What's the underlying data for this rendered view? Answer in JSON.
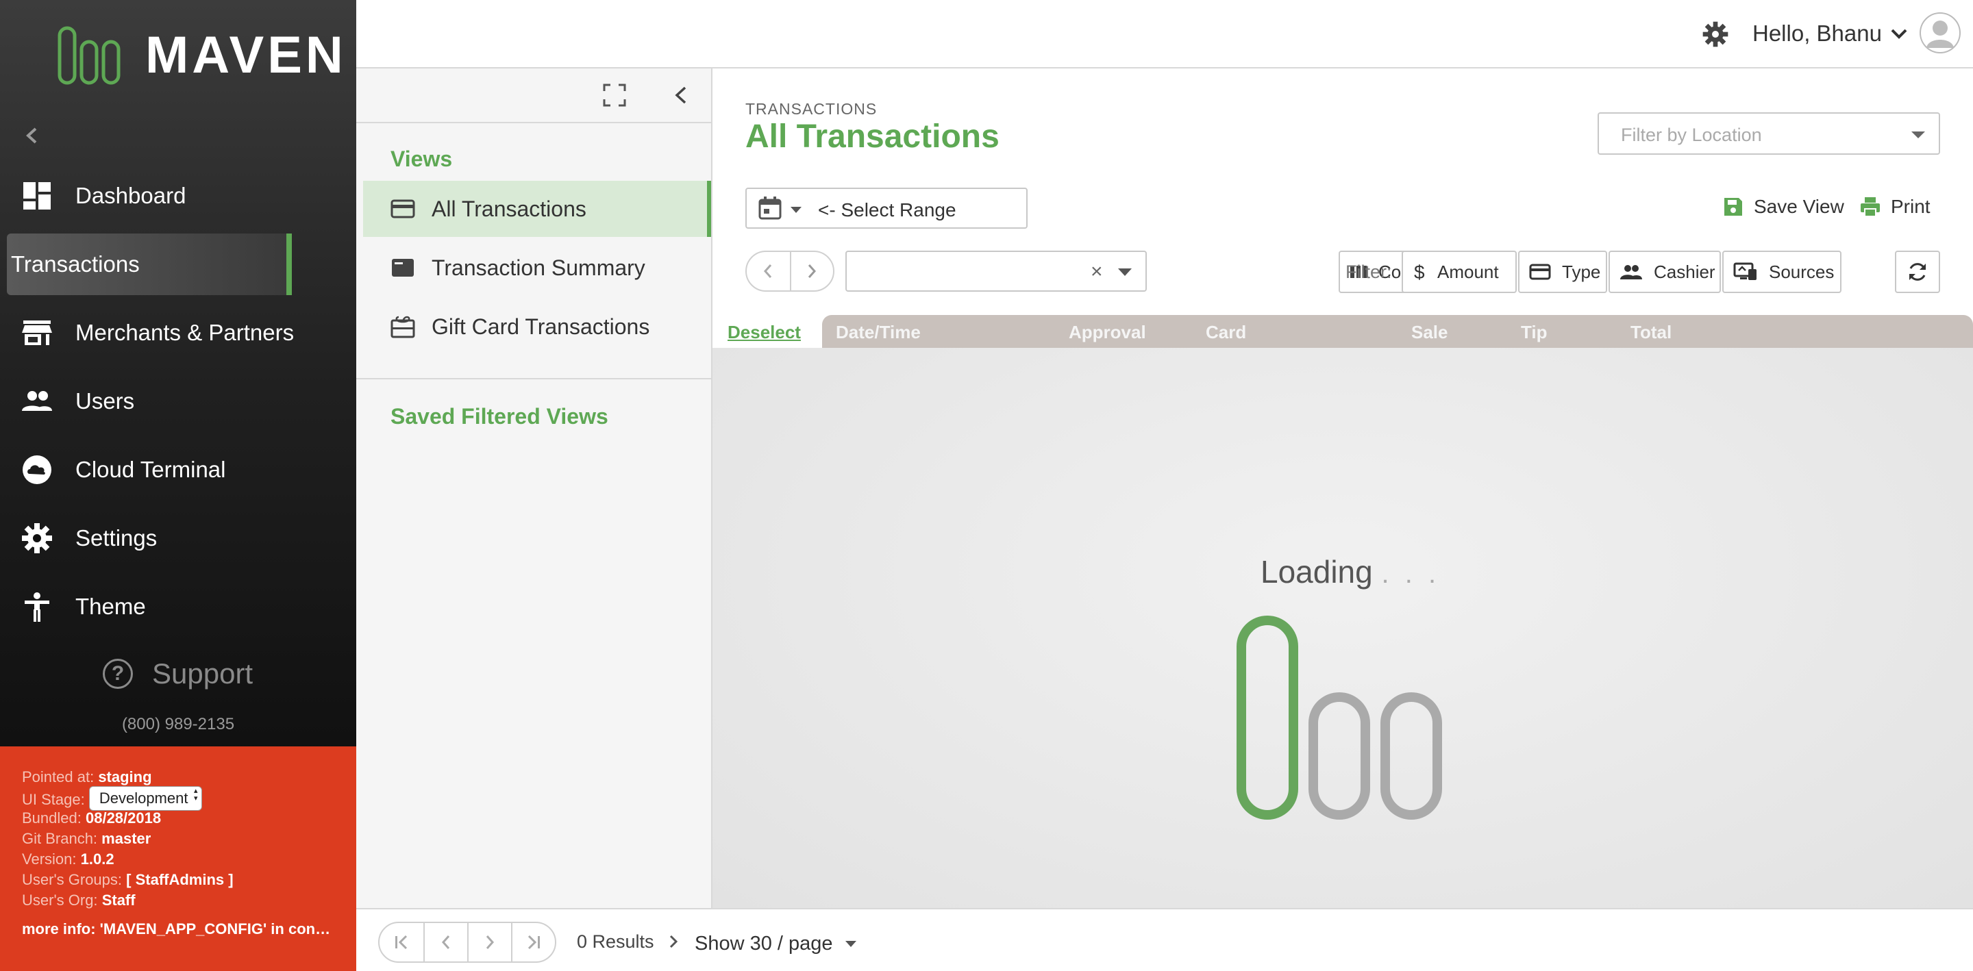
{
  "app": {
    "logo_text": "MAVEN",
    "accent_color": "#5ea854",
    "devbox_color": "#dc3c1f"
  },
  "sidebar": {
    "items": [
      {
        "label": "Dashboard",
        "icon": "dashboard-icon"
      },
      {
        "label": "Transactions",
        "icon": "",
        "active": true
      },
      {
        "label": "Merchants & Partners",
        "icon": "store-icon"
      },
      {
        "label": "Users",
        "icon": "users-icon"
      },
      {
        "label": "Cloud Terminal",
        "icon": "cloud-icon"
      },
      {
        "label": "Settings",
        "icon": "gear-icon"
      },
      {
        "label": "Theme",
        "icon": "accessibility-icon"
      }
    ],
    "support_label": "Support",
    "support_phone": "(800) 989-2135"
  },
  "devinfo": {
    "pointed_at_label": "Pointed at:",
    "pointed_at": "staging",
    "ui_stage_label": "UI Stage:",
    "ui_stage": "Development",
    "bundled_label": "Bundled:",
    "bundled": "08/28/2018",
    "git_branch_label": "Git Branch:",
    "git_branch": "master",
    "version_label": "Version:",
    "version": "1.0.2",
    "groups_label": "User's Groups:",
    "groups": "[ StaffAdmins ]",
    "org_label": "User's Org:",
    "org": "Staff",
    "more_info": "more info: 'MAVEN_APP_CONFIG' in console"
  },
  "header": {
    "greeting": "Hello, Bhanu"
  },
  "views_panel": {
    "views_title": "Views",
    "views": [
      {
        "label": "All Transactions",
        "icon": "card-icon",
        "active": true
      },
      {
        "label": "Transaction Summary",
        "icon": "summary-icon"
      },
      {
        "label": "Gift Card Transactions",
        "icon": "gift-card-icon"
      }
    ],
    "saved_title": "Saved Filtered Views"
  },
  "main": {
    "breadcrumb": "TRANSACTIONS",
    "title": "All Transactions",
    "location_placeholder": "Filter by Location",
    "range_label": "<- Select Range",
    "save_view_label": "Save View",
    "print_label": "Print",
    "column_label": "Column",
    "filter_label": "Filter:",
    "filters": [
      "Amount",
      "Type",
      "Cashier",
      "Sources"
    ],
    "deselect_label": "Deselect",
    "columns": [
      "Date/Time",
      "Approval",
      "Card",
      "Sale",
      "Tip",
      "Total"
    ],
    "loading_text": "Loading",
    "loading_dots": ". . ."
  },
  "footer": {
    "results": "0 Results",
    "per_page": "Show 30 / page"
  }
}
